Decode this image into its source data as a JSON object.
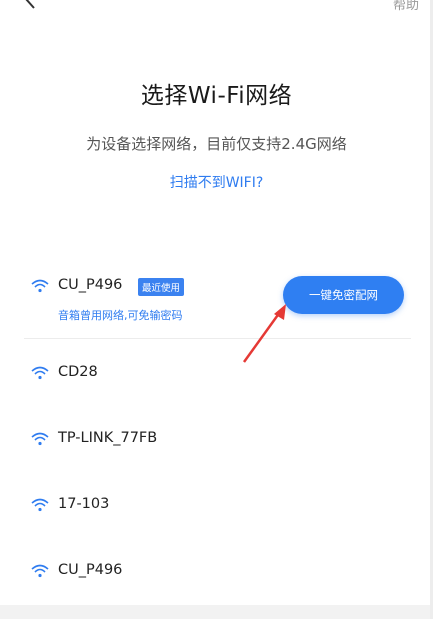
{
  "header": {
    "help_label": "帮助"
  },
  "title": "选择Wi-Fi网络",
  "subtitle": "为设备选择网络，目前仅支持2.4G网络",
  "scan_link": "扫描不到WIFI?",
  "recommended": {
    "ssid": "CU_P496",
    "badge": "最近使用",
    "hint": "音箱曾用网络,可免输密码",
    "button_label": "一键免密配网"
  },
  "networks": [
    {
      "ssid": "CD28"
    },
    {
      "ssid": "TP-LINK_77FB"
    },
    {
      "ssid": "17-103"
    },
    {
      "ssid": "CU_P496"
    }
  ],
  "colors": {
    "accent": "#2f7ff2",
    "badge": "#3b82f0",
    "annotation_arrow": "#e53935"
  },
  "icons": {
    "back": "chevron-left-icon",
    "wifi": "wifi-icon"
  }
}
